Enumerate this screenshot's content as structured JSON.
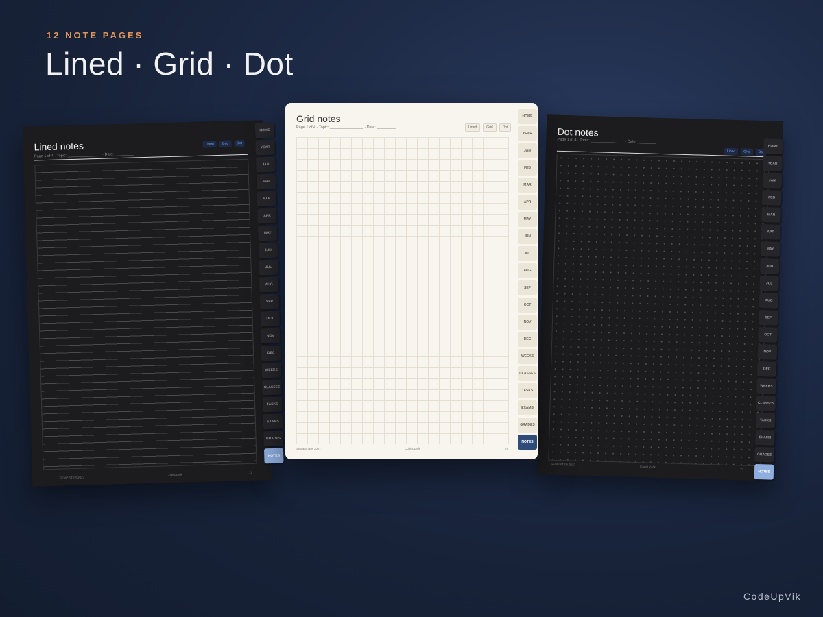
{
  "header": {
    "kicker": "12 NOTE PAGES",
    "title": "Lined · Grid · Dot"
  },
  "brand": "CodeUpVik",
  "colors": {
    "accent": "#e0935a",
    "active_tab_dark": "#8faee0",
    "active_tab_light": "#2f4b7a"
  },
  "pages": {
    "lined": {
      "title": "Lined notes",
      "subtitle": "Page 1 of 4 · Topic: ________________ · Date: _________",
      "chips": [
        "Lined",
        "Grid",
        "Dot"
      ],
      "footer_left": "SEMESTER 2027",
      "footer_center": "CodeUpVik",
      "footer_right": "73",
      "tabs": [
        "HOME",
        "YEAR",
        "JAN",
        "FEB",
        "MAR",
        "APR",
        "MAY",
        "JUN",
        "JUL",
        "AUG",
        "SEP",
        "OCT",
        "NOV",
        "DEC",
        "WEEKS",
        "CLASSES",
        "TASKS",
        "EXAMS",
        "GRADES",
        "NOTES"
      ]
    },
    "grid": {
      "title": "Grid notes",
      "subtitle": "Page 1 of 4 · Topic: ________________ · Date: _________",
      "chips": [
        "Lined",
        "Grid",
        "Dot"
      ],
      "footer_left": "SEMESTER 2027",
      "footer_center": "CodeUpVik",
      "footer_right": "75",
      "tabs": [
        "HOME",
        "YEAR",
        "JAN",
        "FEB",
        "MAR",
        "APR",
        "MAY",
        "JUN",
        "JUL",
        "AUG",
        "SEP",
        "OCT",
        "NOV",
        "DEC",
        "WEEKS",
        "CLASSES",
        "TASKS",
        "EXAMS",
        "GRADES",
        "NOTES"
      ]
    },
    "dot": {
      "title": "Dot notes",
      "subtitle": "Page 1 of 4 · Topic: ________________ · Date: _________",
      "chips": [
        "Lined",
        "Grid",
        "Dot"
      ],
      "footer_left": "SEMESTER 2027",
      "footer_center": "CodeUpVik",
      "footer_right": "77",
      "tabs": [
        "HOME",
        "YEAR",
        "JAN",
        "FEB",
        "MAR",
        "APR",
        "MAY",
        "JUN",
        "JUL",
        "AUG",
        "SEP",
        "OCT",
        "NOV",
        "DEC",
        "WEEKS",
        "CLASSES",
        "TASKS",
        "EXAMS",
        "GRADES",
        "NOTES"
      ]
    }
  }
}
